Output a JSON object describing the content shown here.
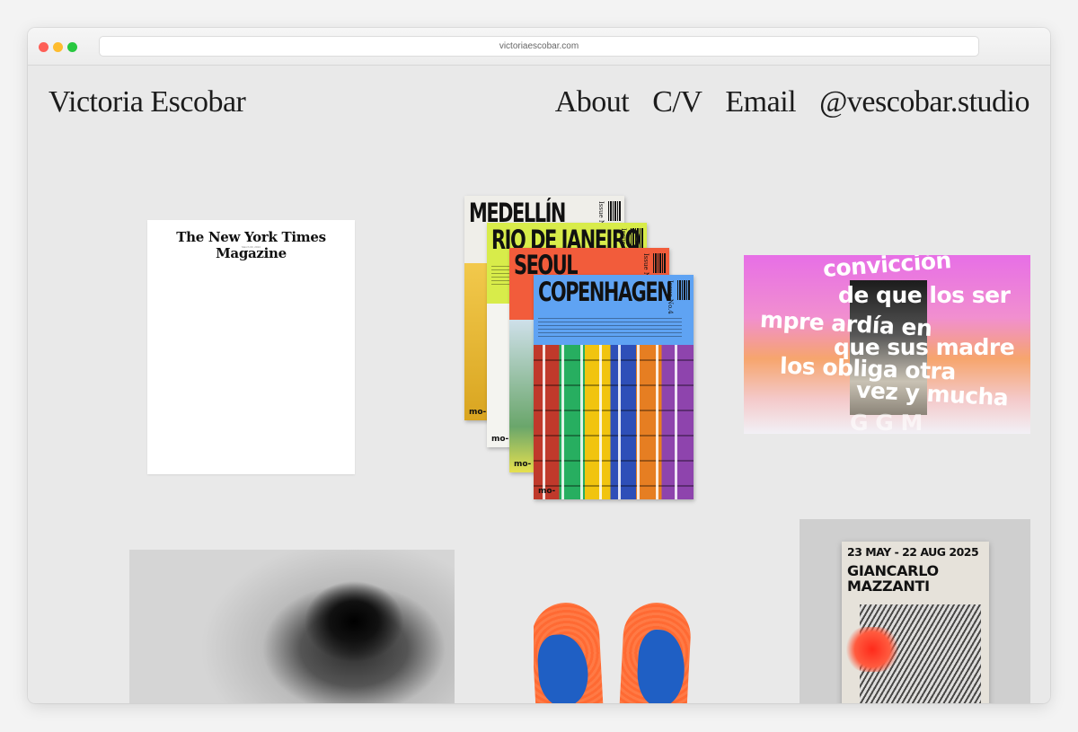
{
  "browser": {
    "url": "victoriaescobar.com"
  },
  "site": {
    "title": "Victoria Escobar"
  },
  "nav": {
    "items": [
      {
        "label": "About"
      },
      {
        "label": "C/V"
      },
      {
        "label": "Email"
      },
      {
        "label": "@vescobar.studio"
      }
    ]
  },
  "works": {
    "nyt": {
      "title": "The New York Times Magazine",
      "date": "March 00, 2024"
    },
    "magazines": {
      "covers": [
        {
          "title": "MEDELLÍN",
          "issue": "Issue No.1",
          "footer": "mo-"
        },
        {
          "title": "RIO DE JANEIRO",
          "issue": "Issue No.2",
          "footer": "mo-"
        },
        {
          "title": "SEOUL",
          "issue": "Issue No.3",
          "footer": "mo-"
        },
        {
          "title": "COPENHAGEN",
          "issue": "Issue No.4",
          "footer": "mo-"
        }
      ]
    },
    "typography": {
      "lines": [
        "convicción",
        "de que los ser",
        "mpre ardía en",
        "que sus madre",
        "los obliga otra",
        "vez y mucha",
        "G G M"
      ]
    },
    "poster": {
      "date": "23 MAY - 22 AUG 2025",
      "name_line1": "GIANCARLO",
      "name_line2": "MAZZANTI"
    }
  },
  "colors": {
    "page_bg": "#e9e9e9",
    "text": "#1c1c1c"
  }
}
